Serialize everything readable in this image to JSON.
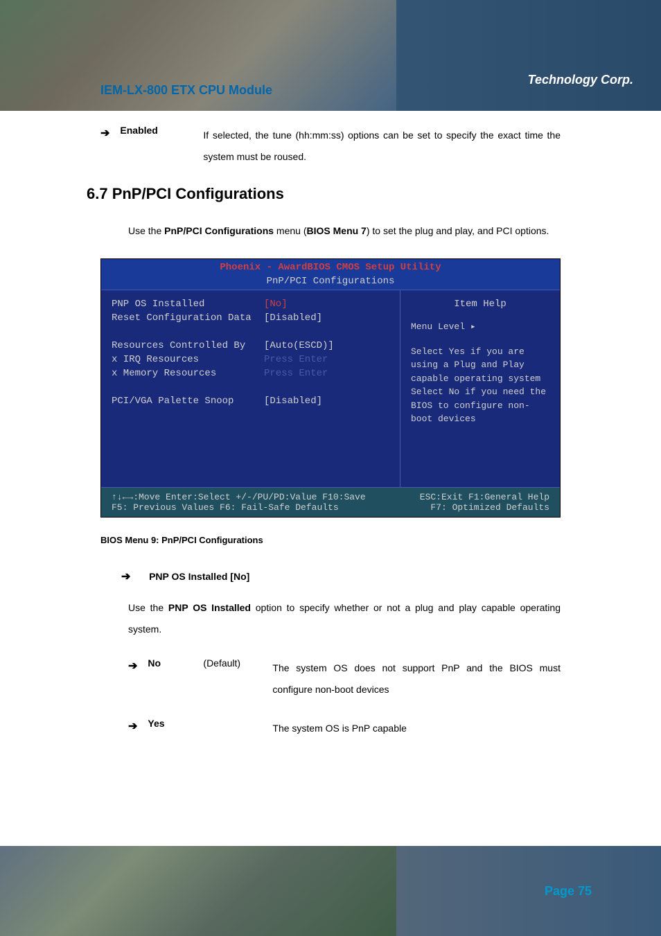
{
  "header": {
    "company": "Technology Corp.",
    "product": "IEM-LX-800 ETX CPU Module"
  },
  "prev_option": {
    "label": "Enabled",
    "desc": "If selected, the tune (hh:mm:ss) options can be set to specify the exact time the system must be roused."
  },
  "section": {
    "heading": "6.7 PnP/PCI Configurations",
    "intro_pre": "Use the ",
    "intro_bold1": "PnP/PCI Configurations",
    "intro_mid": " menu (",
    "intro_bold2": "BIOS Menu 7",
    "intro_post": ") to set the plug and play, and PCI options."
  },
  "bios": {
    "title": "Phoenix - AwardBIOS CMOS Setup Utility",
    "subtitle": "PnP/PCI Configurations",
    "items": [
      {
        "name": "PNP OS Installed",
        "value": "[No]",
        "red": true
      },
      {
        "name": "Reset Configuration Data",
        "value": "[Disabled]"
      },
      {
        "name": "",
        "value": ""
      },
      {
        "name": "Resources Controlled By",
        "value": "[Auto(ESCD)]"
      },
      {
        "name": "x IRQ Resources",
        "value": "Press Enter",
        "disabled": true
      },
      {
        "name": "x Memory Resources",
        "value": "Press Enter",
        "disabled": true
      },
      {
        "name": "",
        "value": ""
      },
      {
        "name": "PCI/VGA Palette Snoop",
        "value": "[Disabled]"
      }
    ],
    "help_title": "Item Help",
    "menu_level": "Menu Level   ▸",
    "help_text": "Select Yes if you are using a Plug and Play capable operating system Select No if you need the BIOS to configure non-boot devices",
    "footer1_left": "↑↓←→:Move  Enter:Select  +/-/PU/PD:Value  F10:Save",
    "footer1_right": "ESC:Exit  F1:General Help",
    "footer2_left": "F5: Previous Values   F6: Fail-Safe Defaults",
    "footer2_right": "F7: Optimized Defaults"
  },
  "caption": "BIOS Menu 9: PnP/PCI Configurations",
  "sub_option": {
    "heading": "PNP OS Installed [No]",
    "intro_pre": "Use the ",
    "intro_bold": "PNP OS Installed",
    "intro_post": " option to specify whether or not a plug and play capable operating system.",
    "options": [
      {
        "label": "No",
        "default": "(Default)",
        "desc": "The system OS does not support PnP and the BIOS must configure non-boot devices"
      },
      {
        "label": "Yes",
        "default": "",
        "desc": "The system OS is PnP capable"
      }
    ]
  },
  "page": "Page 75"
}
